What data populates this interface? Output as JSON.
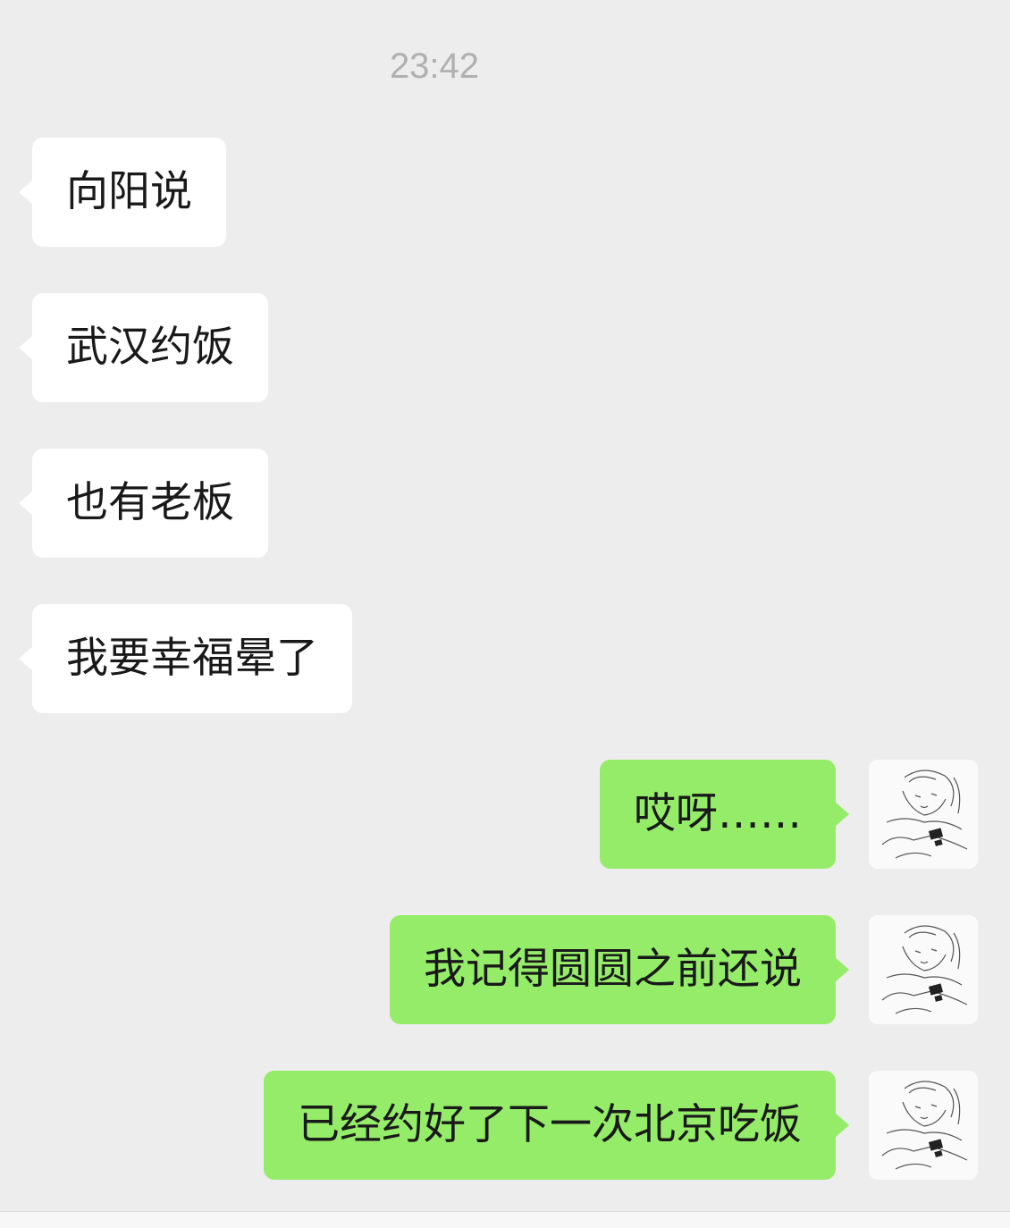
{
  "chat": {
    "timestamp": "23:42",
    "incoming": [
      "向阳说",
      "武汉约饭",
      "也有老板",
      "我要幸福晕了"
    ],
    "outgoing": [
      "哎呀……",
      "我记得圆圆之前还说",
      "已经约好了下一次北京吃饭"
    ]
  },
  "colors": {
    "background": "#ededed",
    "incoming_bubble": "#ffffff",
    "outgoing_bubble": "#95ec69",
    "timestamp_text": "#b0b0b0"
  },
  "icons": {
    "avatar": "sketch-portrait-avatar"
  }
}
